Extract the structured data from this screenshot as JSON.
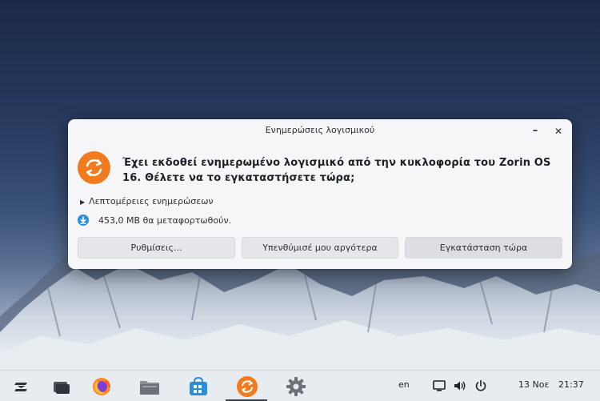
{
  "dialog": {
    "title": "Ενημερώσεις λογισμικού",
    "headline": "Έχει εκδοθεί ενημερωμένο λογισμικό από την κυκλοφορία του Zorin OS 16. Θέλετε να το εγκαταστήσετε τώρα;",
    "details_label": "Λεπτομέρειες ενημερώσεων",
    "download_text": "453,0 MB θα μεταφορτωθούν.",
    "buttons": {
      "settings": "Ρυθμίσεις...",
      "remind": "Υπενθύμισέ μου αργότερα",
      "install": "Εγκατάσταση τώρα"
    },
    "minimize_glyph": "–",
    "close_glyph": "✕",
    "accent_color": "#f27a1f"
  },
  "taskbar": {
    "apps": [
      {
        "name": "zorin-menu",
        "icon": "zorin-logo-icon"
      },
      {
        "name": "workspaces",
        "icon": "window-switcher-icon"
      },
      {
        "name": "firefox",
        "icon": "firefox-icon"
      },
      {
        "name": "files",
        "icon": "folder-icon"
      },
      {
        "name": "software",
        "icon": "store-bag-icon"
      },
      {
        "name": "software-updater",
        "icon": "update-icon",
        "active": true
      },
      {
        "name": "settings",
        "icon": "gear-icon"
      }
    ],
    "tray": {
      "language": "en",
      "date": "13 Νοε",
      "time": "21:37"
    }
  }
}
